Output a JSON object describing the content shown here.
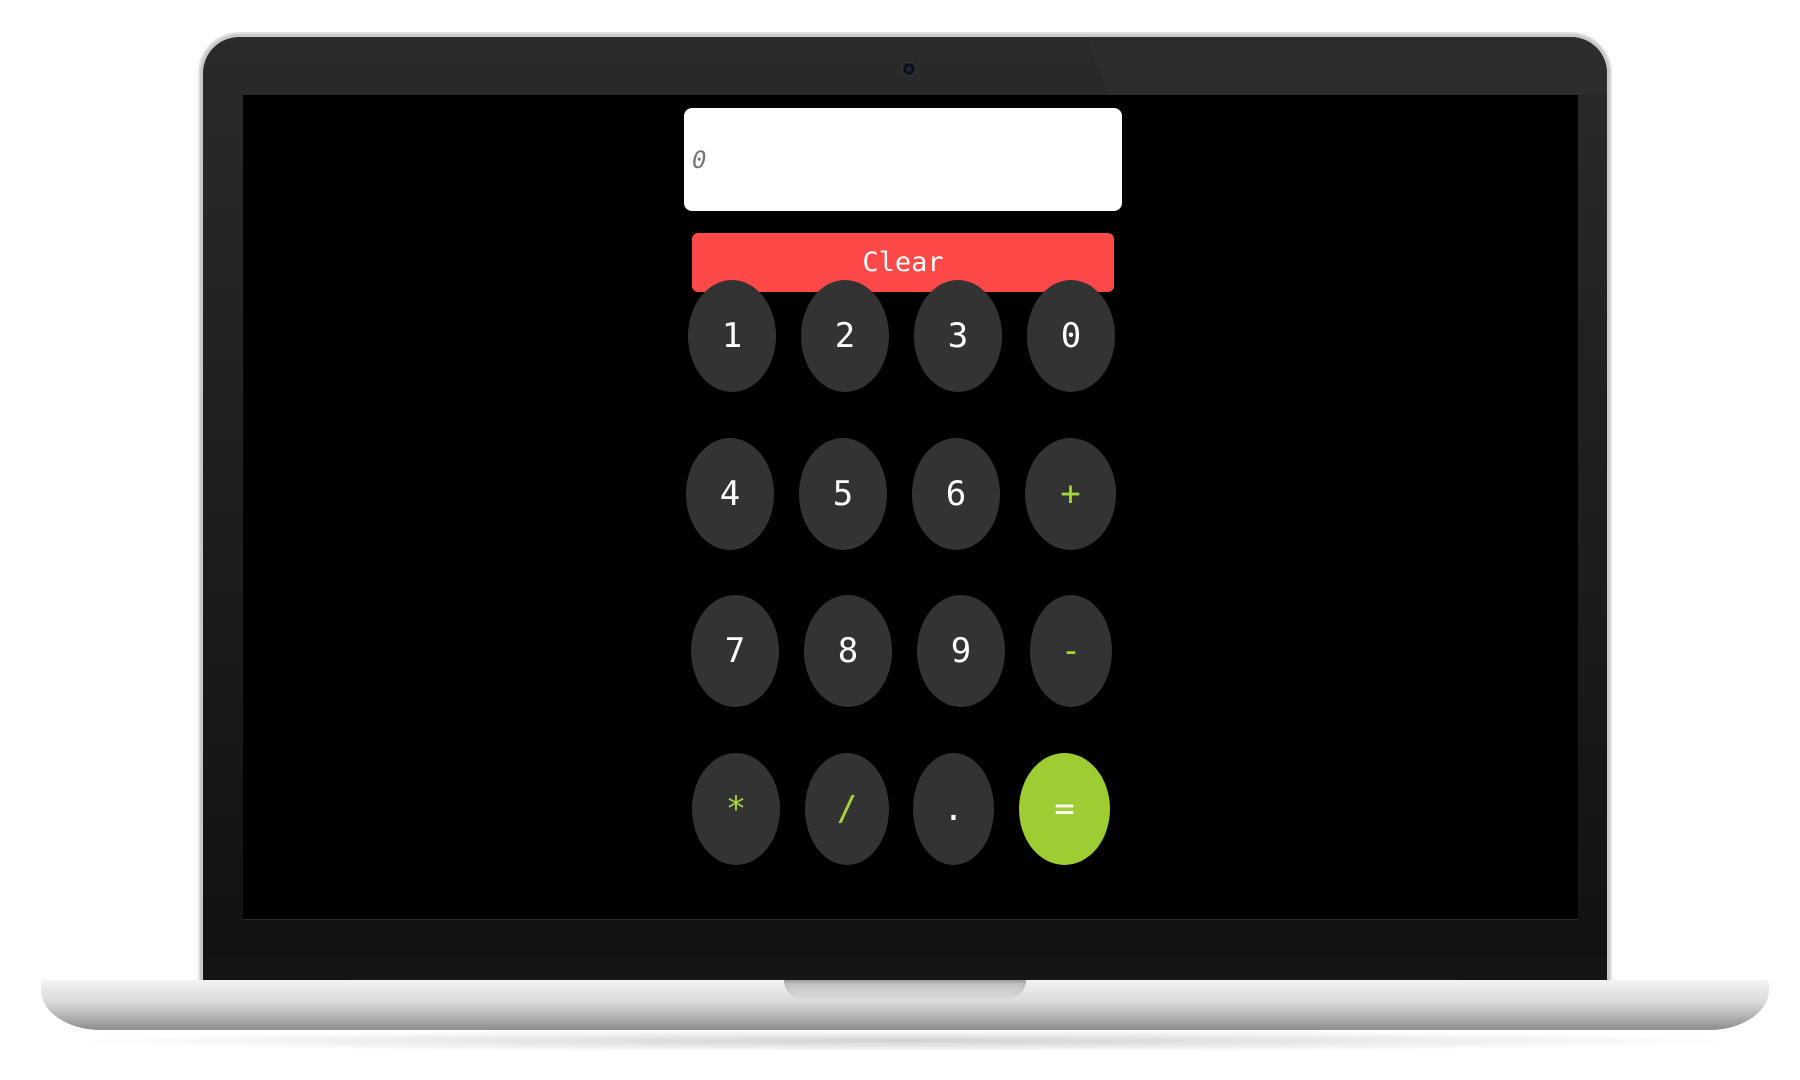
{
  "display": {
    "placeholder": "0"
  },
  "clear": {
    "label": "Clear"
  },
  "keys": {
    "row1": [
      "1",
      "2",
      "3",
      "0"
    ],
    "row2": [
      "4",
      "5",
      "6",
      "+"
    ],
    "row3": [
      "7",
      "8",
      "9",
      "-"
    ],
    "row4": [
      "*",
      "/",
      ".",
      "="
    ]
  },
  "colors": {
    "background": "#000000",
    "display_bg": "#ffffff",
    "clear_button": "#ff4848",
    "key_bg": "#333333",
    "operator_text": "#a6d23c",
    "equals_bg": "#9dcc33"
  }
}
